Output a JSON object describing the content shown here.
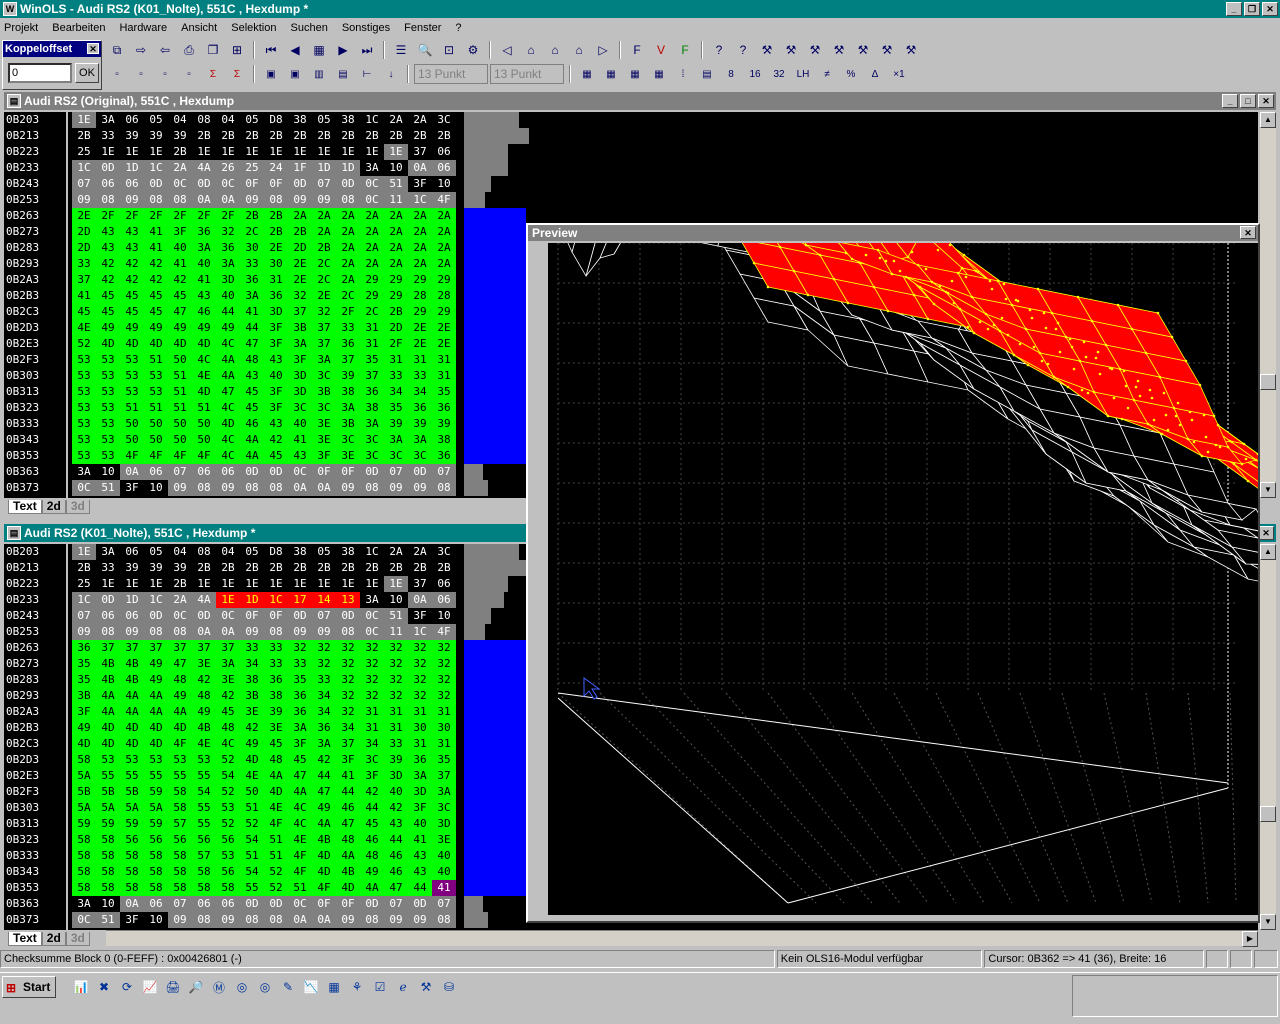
{
  "app": {
    "title": "WinOLS - Audi RS2 (K01_Nolte), 551C , Hexdump *"
  },
  "menu": [
    "Projekt",
    "Bearbeiten",
    "Hardware",
    "Ansicht",
    "Selektion",
    "Suchen",
    "Sonstiges",
    "Fenster",
    "?"
  ],
  "toolbar": {
    "spin1": "13 Punkt",
    "spin2": "13 Punkt"
  },
  "koppel": {
    "title": "Koppeloffset",
    "value": "0",
    "ok": "OK"
  },
  "win1": {
    "title": "Audi RS2 (Original), 551C , Hexdump"
  },
  "win2": {
    "title": "Audi RS2 (K01_Nolte), 551C , Hexdump *"
  },
  "tabs": [
    "Text",
    "2d",
    "3d"
  ],
  "preview": {
    "title": "Preview"
  },
  "colors": {
    "green": "#00ff00",
    "gray": "#808080",
    "red": "#ff0000",
    "blue": "#0000ff",
    "teal": "#008080",
    "mesh": "#ff0000",
    "node": "#ffff00",
    "purple": "#800080"
  },
  "hex1": [
    {
      "a": "0B203",
      "v": "1E 3A 06 05 04 08 04 05 D8 38 05 38 1C 2A 2A 3C",
      "c": "kbbbbbbbbbbbbbbbb"
    },
    {
      "a": "0B213",
      "v": "2B 33 39 39 39 2B 2B 2B 2B 2B 2B 2B 2B 2B 2B 2B",
      "c": "bbbbbbbbbbbbbbbb"
    },
    {
      "a": "0B223",
      "v": "25 1E 1E 1E 2B 1E 1E 1E 1E 1E 1E 1E 1E 1E 37 06",
      "c": "bbbbbbbbbbbbbkbb"
    },
    {
      "a": "0B233",
      "v": "1C 0D 1D 1C 2A 4A 26 25 24 1F 1D 1D 3A 10 0A 06",
      "c": "kkkkkkkkkkkkbbkk"
    },
    {
      "a": "0B243",
      "v": "07 06 06 0D 0C 0D 0C 0F 0F 0D 07 0D 0C 51 3F 10",
      "c": "kkkkkkkkkkkkkkbb"
    },
    {
      "a": "0B253",
      "v": "09 08 09 08 08 0A 0A 09 08 09 09 08 0C 11 1C 4F",
      "c": "kkkkkkkkkkkkkkkk"
    },
    {
      "a": "0B263",
      "v": "2E 2F 2F 2F 2F 2F 2F 2B 2B 2A 2A 2A 2A 2A 2A 2A",
      "c": "gggggggggggggggg"
    },
    {
      "a": "0B273",
      "v": "2D 43 43 41 3F 36 32 2C 2B 2B 2A 2A 2A 2A 2A 2A",
      "c": "gggggggggggggggg"
    },
    {
      "a": "0B283",
      "v": "2D 43 43 41 40 3A 36 30 2E 2D 2B 2A 2A 2A 2A 2A",
      "c": "gggggggggggggggg"
    },
    {
      "a": "0B293",
      "v": "33 42 42 42 41 40 3A 33 30 2E 2C 2A 2A 2A 2A 2A",
      "c": "gggggggggggggggg"
    },
    {
      "a": "0B2A3",
      "v": "37 42 42 42 42 41 3D 36 31 2E 2C 2A 29 29 29 29",
      "c": "gggggggggggggggg"
    },
    {
      "a": "0B2B3",
      "v": "41 45 45 45 45 43 40 3A 36 32 2E 2C 29 29 28 28",
      "c": "gggggggggggggggg"
    },
    {
      "a": "0B2C3",
      "v": "45 45 45 45 47 46 44 41 3D 37 32 2F 2C 2B 29 29",
      "c": "gggggggggggggggg"
    },
    {
      "a": "0B2D3",
      "v": "4E 49 49 49 49 49 49 44 3F 3B 37 33 31 2D 2E 2E",
      "c": "gggggggggggggggg"
    },
    {
      "a": "0B2E3",
      "v": "52 4D 4D 4D 4D 4D 4C 47 3F 3A 37 36 31 2F 2E 2E",
      "c": "gggggggggggggggg"
    },
    {
      "a": "0B2F3",
      "v": "53 53 53 51 50 4C 4A 48 43 3F 3A 37 35 31 31 31",
      "c": "gggggggggggggggg"
    },
    {
      "a": "0B303",
      "v": "53 53 53 53 51 4E 4A 43 40 3D 3C 39 37 33 33 31",
      "c": "gggggggggggggggg"
    },
    {
      "a": "0B313",
      "v": "53 53 53 53 51 4D 47 45 3F 3D 3B 38 36 34 34 35",
      "c": "gggggggggggggggg"
    },
    {
      "a": "0B323",
      "v": "53 53 51 51 51 51 4C 45 3F 3C 3C 3A 38 35 36 36",
      "c": "gggggggggggggggg"
    },
    {
      "a": "0B333",
      "v": "53 53 50 50 50 50 4D 46 43 40 3E 3B 3A 39 39 39",
      "c": "gggggggggggggggg"
    },
    {
      "a": "0B343",
      "v": "53 53 50 50 50 50 4C 4A 42 41 3E 3C 3C 3A 3A 38",
      "c": "gggggggggggggggg"
    },
    {
      "a": "0B353",
      "v": "53 53 4F 4F 4F 4F 4C 4A 45 43 3F 3E 3C 3C 3C 36",
      "c": "gggggggggggggggg"
    },
    {
      "a": "0B363",
      "v": "3A 10 0A 06 07 06 06 0D 0D 0C 0F 0F 0D 07 0D 07",
      "c": "bbkkkkkkkkkkkkkk"
    },
    {
      "a": "0B373",
      "v": "0C 51 3F 10 09 08 09 08 08 0A 0A 09 08 09 09 08",
      "c": "kkbbkkkkkkkkkkkk"
    }
  ],
  "hex2": [
    {
      "a": "0B203",
      "v": "1E 3A 06 05 04 08 04 05 D8 38 05 38 1C 2A 2A 3C",
      "c": "kbbbbbbbbbbbbbbb"
    },
    {
      "a": "0B213",
      "v": "2B 33 39 39 39 2B 2B 2B 2B 2B 2B 2B 2B 2B 2B 2B",
      "c": "bbbbbbbbbbbbbbbb"
    },
    {
      "a": "0B223",
      "v": "25 1E 1E 1E 2B 1E 1E 1E 1E 1E 1E 1E 1E 1E 37 06",
      "c": "bbbbbbbbbbbbbkbb"
    },
    {
      "a": "0B233",
      "v": "1C 0D 1D 1C 2A 4A 1E 1D 1C 17 14 13 3A 10 0A 06",
      "c": "kkkkkkrrrrrrbbkk"
    },
    {
      "a": "0B243",
      "v": "07 06 06 0D 0C 0D 0C 0F 0F 0D 07 0D 0C 51 3F 10",
      "c": "kkkkkkkkkkkkkkbb"
    },
    {
      "a": "0B253",
      "v": "09 08 09 08 08 0A 0A 09 08 09 09 08 0C 11 1C 4F",
      "c": "kkkkkkkkkkkkkkkk"
    },
    {
      "a": "0B263",
      "v": "36 37 37 37 37 37 37 33 33 32 32 32 32 32 32 32",
      "c": "gggggggggggggggg"
    },
    {
      "a": "0B273",
      "v": "35 4B 4B 49 47 3E 3A 34 33 33 32 32 32 32 32 32",
      "c": "gggggggggggggggg"
    },
    {
      "a": "0B283",
      "v": "35 4B 4B 49 48 42 3E 38 36 35 33 32 32 32 32 32",
      "c": "gggggggggggggggg"
    },
    {
      "a": "0B293",
      "v": "3B 4A 4A 4A 49 48 42 3B 38 36 34 32 32 32 32 32",
      "c": "gggggggggggggggg"
    },
    {
      "a": "0B2A3",
      "v": "3F 4A 4A 4A 4A 49 45 3E 39 36 34 32 31 31 31 31",
      "c": "gggggggggggggggg"
    },
    {
      "a": "0B2B3",
      "v": "49 4D 4D 4D 4D 4B 48 42 3E 3A 36 34 31 31 30 30",
      "c": "gggggggggggggggg"
    },
    {
      "a": "0B2C3",
      "v": "4D 4D 4D 4D 4F 4E 4C 49 45 3F 3A 37 34 33 31 31",
      "c": "gggggggggggggggg"
    },
    {
      "a": "0B2D3",
      "v": "58 53 53 53 53 53 52 4D 48 45 42 3F 3C 39 36 35",
      "c": "gggggggggggggggg"
    },
    {
      "a": "0B2E3",
      "v": "5A 55 55 55 55 55 54 4E 4A 47 44 41 3F 3D 3A 37",
      "c": "gggggggggggggggg"
    },
    {
      "a": "0B2F3",
      "v": "5B 5B 5B 59 58 54 52 50 4D 4A 47 44 42 40 3D 3A",
      "c": "gggggggggggggggg"
    },
    {
      "a": "0B303",
      "v": "5A 5A 5A 5A 58 55 53 51 4E 4C 49 46 44 42 3F 3C",
      "c": "gggggggggggggggg"
    },
    {
      "a": "0B313",
      "v": "59 59 59 59 57 55 52 52 4F 4C 4A 47 45 43 40 3D",
      "c": "gggggggggggggggg"
    },
    {
      "a": "0B323",
      "v": "58 58 56 56 56 56 56 54 51 4E 4B 48 46 44 41 3E",
      "c": "gggggggggggggggg"
    },
    {
      "a": "0B333",
      "v": "58 58 58 58 58 57 53 51 51 4F 4D 4A 48 46 43 40",
      "c": "gggggggggggggggg"
    },
    {
      "a": "0B343",
      "v": "58 58 58 58 58 58 56 54 52 4F 4D 4B 49 46 43 40",
      "c": "gggggggggggggggg"
    },
    {
      "a": "0B353",
      "v": "58 58 58 58 58 58 58 55 52 51 4F 4D 4A 47 44 41",
      "c": "gggggggggggggggp"
    },
    {
      "a": "0B363",
      "v": "3A 10 0A 06 07 06 06 0D 0D 0C 0F 0F 0D 07 0D 07",
      "c": "bbkkkkkkkkkkkkkk"
    },
    {
      "a": "0B373",
      "v": "0C 51 3F 10 09 08 09 08 08 0A 0A 09 08 09 09 08",
      "c": "kkbbkkkkkkkkkkkk"
    }
  ],
  "status": {
    "left": "Checksumme Block 0 (0-FEFF) : 0x00426801 (-)",
    "mid": "Kein OLS16-Modul verfügbar",
    "right": "Cursor: 0B362 => 41 (36), Breite: 16"
  },
  "taskbar": {
    "start": "Start"
  },
  "icons": {
    "toolbar1": [
      "new-window-icon",
      "export-icon",
      "import-icon",
      "print-icon",
      "copy-window-icon",
      "split-icon",
      "first-icon",
      "prev-icon",
      "grid-icon",
      "next-icon",
      "last-icon",
      "list-icon",
      "zoom-icon",
      "map-icon",
      "connect-icon",
      "back-icon",
      "hw1-icon",
      "hw2-icon",
      "hw3-icon",
      "forward-icon",
      "f-blue-icon",
      "f-red-icon",
      "f-green-icon",
      "help-icon",
      "context-help-icon",
      "tool1-icon",
      "tool2-icon",
      "tool3-icon",
      "tool4-icon",
      "tool5-icon",
      "tool6-icon",
      "tool7-icon"
    ],
    "toolbar2": [
      "doc1-icon",
      "doc2-icon",
      "doc3-icon",
      "doc4-icon",
      "sum-icon",
      "sum2-icon",
      "view1-icon",
      "view2-icon",
      "view3-icon",
      "view4-icon",
      "cursor1-icon",
      "cursor2-icon",
      "hex1-icon",
      "hex2-icon",
      "hex3-icon",
      "hex4-icon",
      "hex5-icon",
      "hex6-icon",
      "col8-icon",
      "col16-icon",
      "col32-icon",
      "lohi-icon",
      "diff-icon",
      "percent-icon",
      "delta-icon",
      "times1-icon"
    ]
  }
}
